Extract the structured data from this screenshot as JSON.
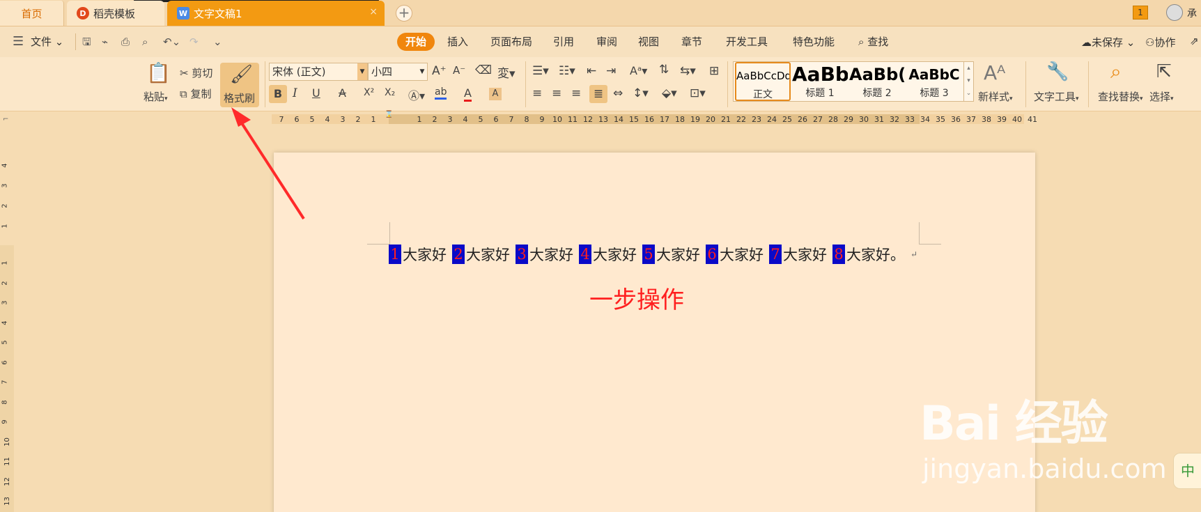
{
  "tabs": {
    "home": "首页",
    "template": "稻壳模板",
    "document": "文字文稿1",
    "add": "+",
    "close": "×",
    "badge": "1",
    "user": "承",
    "template_icon": "D",
    "document_icon": "W"
  },
  "menu": {
    "file": "文件",
    "tabs": [
      "开始",
      "插入",
      "页面布局",
      "引用",
      "审阅",
      "视图",
      "章节",
      "开发工具",
      "特色功能"
    ],
    "find": "查找",
    "unsaved": "未保存",
    "collab": "协作",
    "hamburger_icon": "☰"
  },
  "ribbon": {
    "paste": "粘贴",
    "cut": "剪切",
    "copy": "复制",
    "format_painter": "格式刷",
    "font_name": "宋体 (正文)",
    "font_size": "小四",
    "styles": [
      {
        "sample": "AaBbCcDd",
        "name": "正文"
      },
      {
        "sample": "AaBb",
        "name": "标题 1"
      },
      {
        "sample": "AaBb(",
        "name": "标题 2"
      },
      {
        "sample": "AaBbC",
        "name": "标题 3"
      }
    ],
    "new_style": "新样式",
    "text_tools": "文字工具",
    "find_replace": "查找替换",
    "select": "选择",
    "bold": "B",
    "italic": "I",
    "underline": "U",
    "strike": "A",
    "superscript": "X²",
    "subscript": "X₂",
    "highlight": "ab",
    "font_color": "A",
    "char_shade": "A"
  },
  "ruler": {
    "h_left": [
      "7",
      "6",
      "5",
      "4",
      "3",
      "2",
      "1"
    ],
    "h_right": [
      "1",
      "2",
      "3",
      "4",
      "5",
      "6",
      "7",
      "8",
      "9",
      "10",
      "11",
      "12",
      "13",
      "14",
      "15",
      "16",
      "17",
      "18",
      "19",
      "20",
      "21",
      "22",
      "23",
      "24",
      "25",
      "26",
      "27",
      "28",
      "29",
      "30",
      "31",
      "32",
      "33",
      "34",
      "35",
      "36",
      "37",
      "38",
      "39",
      "40",
      "41"
    ],
    "v_top": [
      "4",
      "3",
      "2",
      "1"
    ],
    "v_bottom": [
      "1",
      "2",
      "3",
      "4",
      "5",
      "6",
      "7",
      "8",
      "9",
      "10",
      "11",
      "12",
      "13"
    ]
  },
  "document": {
    "segments": [
      {
        "num": "1",
        "text": "大家好"
      },
      {
        "num": "2",
        "text": "大家好"
      },
      {
        "num": "3",
        "text": "大家好"
      },
      {
        "num": "4",
        "text": "大家好"
      },
      {
        "num": "5",
        "text": "大家好"
      },
      {
        "num": "6",
        "text": "大家好"
      },
      {
        "num": "7",
        "text": "大家好"
      },
      {
        "num": "8",
        "text": "大家好。"
      }
    ],
    "para_mark": "↵",
    "caption": "一步操作"
  },
  "watermark": {
    "logo": "Bai 经验",
    "url": "jingyan.baidu.com"
  },
  "ime": "中",
  "colors": {
    "accent": "#f0860d",
    "number_bg": "#0a0ac8",
    "number_fg": "#ff1f1f",
    "arrow": "#ff2a2a"
  }
}
